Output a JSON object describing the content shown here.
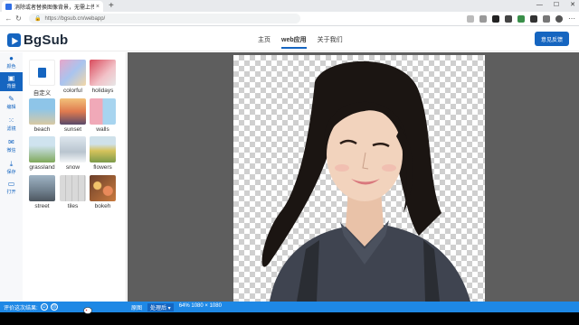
{
  "browser": {
    "tab_title": "消除或者替换图像背景，无需上传",
    "tab_close": "×",
    "new_tab": "+",
    "url": "https://bgsub.cn/webapp/",
    "window_controls": [
      "—",
      "☐",
      "✕"
    ]
  },
  "header": {
    "logo_text": "BgSub",
    "nav": [
      "主页",
      "web应用",
      "关于我们"
    ],
    "active_nav": "web应用",
    "feedback_label": "意见反馈"
  },
  "rail": {
    "items": [
      {
        "label": "颜色",
        "icon": "palette-icon"
      },
      {
        "label": "背景",
        "icon": "image-icon",
        "active": true
      },
      {
        "label": "编辑",
        "icon": "brush-icon"
      },
      {
        "label": "滤镜",
        "icon": "filter-icon"
      },
      {
        "label": "微信",
        "icon": "wechat-icon"
      },
      {
        "label": "保存",
        "icon": "save-icon"
      },
      {
        "label": "打开",
        "icon": "folder-icon"
      }
    ]
  },
  "backgrounds": {
    "custom_label": "自定义",
    "tiles": [
      "colorful",
      "holidays",
      "beach",
      "sunset",
      "walls",
      "grassland",
      "snow",
      "flowers",
      "street",
      "tiles",
      "bokeh"
    ]
  },
  "status": {
    "rate_label": "评价这次结果:",
    "original_label": "原图",
    "processed_label": "处理后 ▾",
    "info": "64% 1080 × 1080"
  },
  "colors": {
    "brand": "#1565c0",
    "status_bar": "#1e88e5",
    "canvas_bg": "#5e5e5e"
  }
}
